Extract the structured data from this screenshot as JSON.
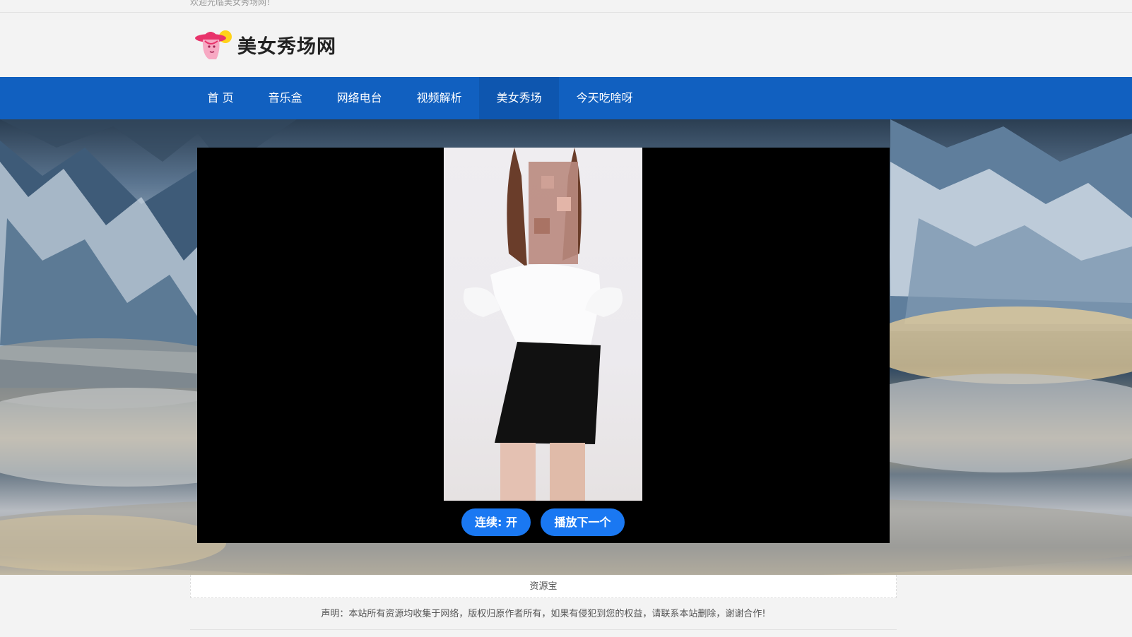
{
  "topbar": {
    "welcome": "欢迎光临美女秀场网！"
  },
  "header": {
    "logo_text": "美女秀场网",
    "logo_icon": "girl-with-hat-logo-icon"
  },
  "nav": {
    "items": [
      {
        "label": "首 页"
      },
      {
        "label": "音乐盒"
      },
      {
        "label": "网络电台"
      },
      {
        "label": "视频解析"
      },
      {
        "label": "美女秀场"
      },
      {
        "label": "今天吃啥呀"
      }
    ],
    "active_label": "美女秀场",
    "color": "#1160c0"
  },
  "player": {
    "loop_button": "连续: 开",
    "next_button": "播放下一个",
    "button_color": "#1a78f2"
  },
  "footer": {
    "source": "资源宝",
    "declaration": "声明：本站所有资源均收集于网络，版权归原作者所有，如果有侵犯到您的权益，请联系本站删除，谢谢合作!"
  }
}
